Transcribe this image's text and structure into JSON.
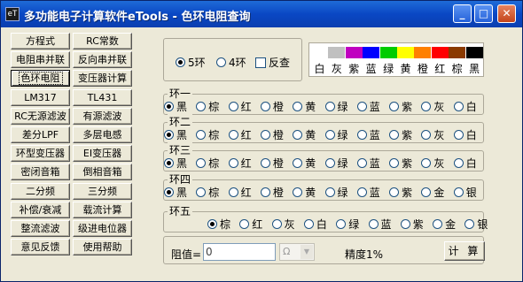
{
  "window": {
    "title": "多功能电子计算软件eTools - 色环电阻查询",
    "app_icon_text": "eT"
  },
  "sidebar": {
    "buttons": [
      "方程式",
      "RC常数",
      "电阻串并联",
      "反向串并联",
      "色环电阻",
      "变压器计算",
      "LM317",
      "TL431",
      "RC无源滤波",
      "有源滤波",
      "差分LPF",
      "多层电感",
      "环型变压器",
      "EI变压器",
      "密闭音箱",
      "倒相音箱",
      "二分频",
      "三分频",
      "补偿/衰减",
      "载流计算",
      "整流滤波",
      "级进电位器",
      "意见反馈",
      "使用帮助"
    ],
    "active_index": 4
  },
  "mode": {
    "five_ring": "5环",
    "four_ring": "4环",
    "reverse": "反查",
    "selected": "five_ring"
  },
  "legend": {
    "colors": [
      "#ffffff",
      "#c0c0c0",
      "#c000c0",
      "#0000ff",
      "#00cc00",
      "#ffff00",
      "#ff8000",
      "#ff0000",
      "#8b3a00",
      "#000000"
    ],
    "labels": [
      "白",
      "灰",
      "紫",
      "蓝",
      "绿",
      "黄",
      "橙",
      "红",
      "棕",
      "黑"
    ]
  },
  "rings": [
    {
      "label": "环一",
      "options": [
        "黑",
        "棕",
        "红",
        "橙",
        "黄",
        "绿",
        "蓝",
        "紫",
        "灰",
        "白"
      ],
      "selected": 0
    },
    {
      "label": "环二",
      "options": [
        "黑",
        "棕",
        "红",
        "橙",
        "黄",
        "绿",
        "蓝",
        "紫",
        "灰",
        "白"
      ],
      "selected": 0
    },
    {
      "label": "环三",
      "options": [
        "黑",
        "棕",
        "红",
        "橙",
        "黄",
        "绿",
        "蓝",
        "紫",
        "灰",
        "白"
      ],
      "selected": 0
    },
    {
      "label": "环四",
      "options": [
        "黑",
        "棕",
        "红",
        "橙",
        "黄",
        "绿",
        "蓝",
        "紫",
        "金",
        "银"
      ],
      "selected": 0
    },
    {
      "label": "环五",
      "options": [
        "棕",
        "红",
        "灰",
        "白",
        "绿",
        "蓝",
        "紫",
        "金",
        "银"
      ],
      "selected": 0
    }
  ],
  "result": {
    "label": "阻值=",
    "value": "0",
    "unit": "Ω",
    "precision": "精度1%",
    "calc_button": "计 算"
  }
}
